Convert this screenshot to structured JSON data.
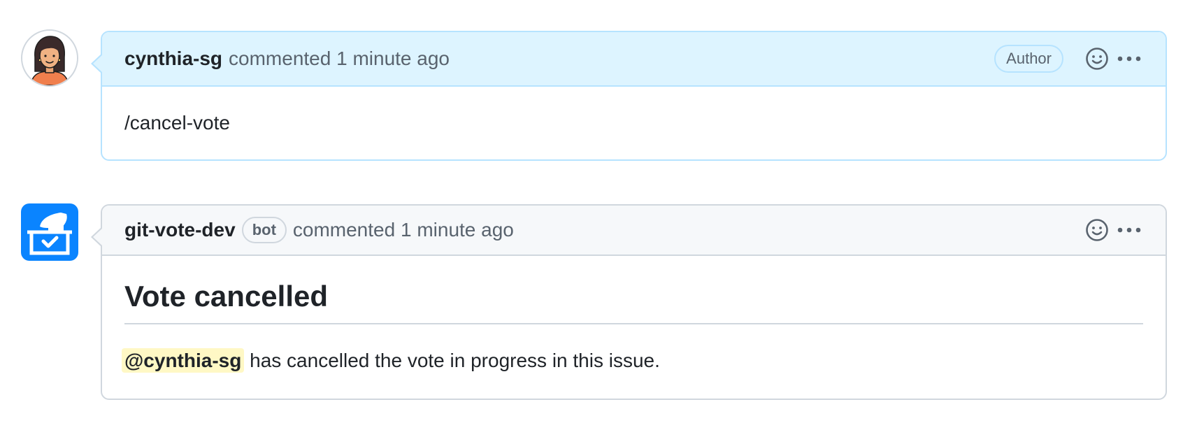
{
  "comments": [
    {
      "username": "cynthia-sg",
      "action": "commented",
      "time": "1 minute ago",
      "badge": "Author",
      "body": "/cancel-vote"
    },
    {
      "username": "git-vote-dev",
      "bot_label": "bot",
      "action": "commented",
      "time": "1 minute ago",
      "title": "Vote cancelled",
      "mention": "@cynthia-sg",
      "body_rest": " has cancelled the vote in progress in this issue."
    }
  ],
  "icons": {
    "reaction": "smiley-icon",
    "more": "kebab-horizontal-icon",
    "bot_avatar": "ballot-box-icon"
  },
  "colors": {
    "author_header_bg": "#ddf4ff",
    "author_border": "#b6e3ff",
    "default_header_bg": "#f6f8fa",
    "border": "#d0d7de",
    "mention_bg": "#fff8c5",
    "bot_avatar_bg": "#0a84ff"
  }
}
